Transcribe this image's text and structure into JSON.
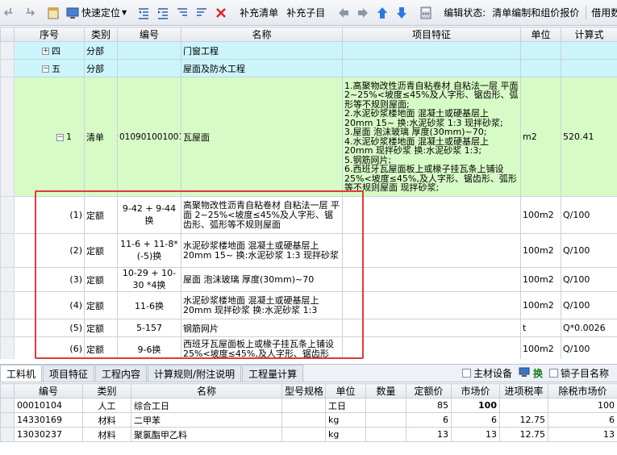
{
  "toolbar": {
    "locate_label": "快速定位",
    "add_list_label": "补充清单",
    "add_sub_label": "补充子目",
    "status_label": "编辑状态:",
    "status_value": "清单编制和组价报价",
    "more_label": "借用数"
  },
  "top_grid": {
    "columns": [
      "序号",
      "类别",
      "编号",
      "名称",
      "项目特征",
      "单位",
      "计算式"
    ],
    "rows": [
      {
        "seq": "四",
        "type": "分部",
        "code": "",
        "name": "门窗工程",
        "feature": "",
        "unit": "",
        "formula": "",
        "tree": "+",
        "style": "cyan"
      },
      {
        "seq": "五",
        "type": "分部",
        "code": "",
        "name": "屋面及防水工程",
        "feature": "",
        "unit": "",
        "formula": "",
        "tree": "−",
        "style": "cyan"
      },
      {
        "seq": "1",
        "type": "清单",
        "code": "010901001001",
        "name": "瓦屋面",
        "feature": "1.高聚物改性沥青自粘卷材 自粘法一层 平面 2~25%<坡度≤45%及人字形、锯齿形、弧形等不规则屋面;\n2.水泥砂浆楼地面 混凝土或硬基层上 20mm 15~ 换:水泥砂浆 1:3 现拌砂浆;\n3.屋面 泡沫玻璃 厚度(30mm)~70;\n4.水泥砂浆楼地面 混凝土或硬基层上 20mm 现拌砂浆 换:水泥砂浆 1:3;\n5.钢筋网片;\n6.西班牙瓦屋面板上或椽子挂瓦条上铺设 25%<坡度≤45%,及人字形、锯齿形、弧形等不规则屋面 现拌砂浆;",
        "unit": "m2",
        "formula": "520.41",
        "tree": "−",
        "style": "green"
      },
      {
        "seq": "(1)",
        "type": "定额",
        "code": "9-42 + 9-44换",
        "name": "高聚物改性沥青自粘卷材 自粘法一层 平面 2~25%<坡度≤45%及人字形、锯齿形、弧形等不规则屋面",
        "feature": "",
        "unit": "100m2",
        "formula": "Q/100",
        "style": "white"
      },
      {
        "seq": "(2)",
        "type": "定额",
        "code": "11-6 + 11-8*(-5)换",
        "name": "水泥砂浆楼地面 混凝土或硬基层上 20mm 15~ 换:水泥砂浆 1:3 现拌砂浆",
        "feature": "",
        "unit": "100m2",
        "formula": "Q/100",
        "style": "white"
      },
      {
        "seq": "(3)",
        "type": "定额",
        "code": "10-29 + 10-30 *4换",
        "name": "屋面 泡沫玻璃 厚度(30mm)~70",
        "feature": "",
        "unit": "100m2",
        "formula": "Q/100",
        "style": "white"
      },
      {
        "seq": "(4)",
        "type": "定额",
        "code": "11-6换",
        "name": "水泥砂浆楼地面 混凝土或硬基层上 20mm 现拌砂浆 换:水泥砂浆 1:3",
        "feature": "",
        "unit": "100m2",
        "formula": "Q/100",
        "style": "white"
      },
      {
        "seq": "(5)",
        "type": "定额",
        "code": "5-157",
        "name": "钢筋网片",
        "feature": "",
        "unit": "t",
        "formula": "Q*0.0026",
        "style": "white"
      },
      {
        "seq": "(6)",
        "type": "定额",
        "code": "9-6换",
        "name": "西班牙瓦屋面板上或椽子挂瓦条上铺设 25%<坡度≤45%,及人字形、锯齿形",
        "feature": "",
        "unit": "100m2",
        "formula": "Q/100",
        "style": "white"
      }
    ]
  },
  "tabs": {
    "items": [
      "工料机",
      "项目特征",
      "工程内容",
      "计算规则/附注说明",
      "工程量计算"
    ],
    "active": 0,
    "main_material_label": "主材设备",
    "swap_label": "换",
    "lock_label": "锁子目名称"
  },
  "bottom_grid": {
    "columns": [
      "编号",
      "类别",
      "名称",
      "型号规格",
      "单位",
      "数量",
      "定额价",
      "市场价",
      "进项税率",
      "除税市场价"
    ],
    "rows": [
      {
        "code": "00010104",
        "type": "人工",
        "name": "综合工日",
        "spec": "",
        "unit": "工日",
        "qty": "",
        "quota": "85",
        "market": "100",
        "tax": "",
        "net": "100"
      },
      {
        "code": "14330169",
        "type": "材料",
        "name": "二甲苯",
        "spec": "",
        "unit": "kg",
        "qty": "",
        "quota": "6",
        "market": "6",
        "tax": "12.75",
        "net": "6"
      },
      {
        "code": "13030237",
        "type": "材料",
        "name": "聚氯酯甲乙料",
        "spec": "",
        "unit": "kg",
        "qty": "",
        "quota": "13",
        "market": "13",
        "tax": "12.75",
        "net": "13"
      }
    ]
  },
  "colors": {
    "cyan_row": "#ccf5fb",
    "green_row": "#d7fbc6",
    "highlight_border": "#e03a3a"
  }
}
